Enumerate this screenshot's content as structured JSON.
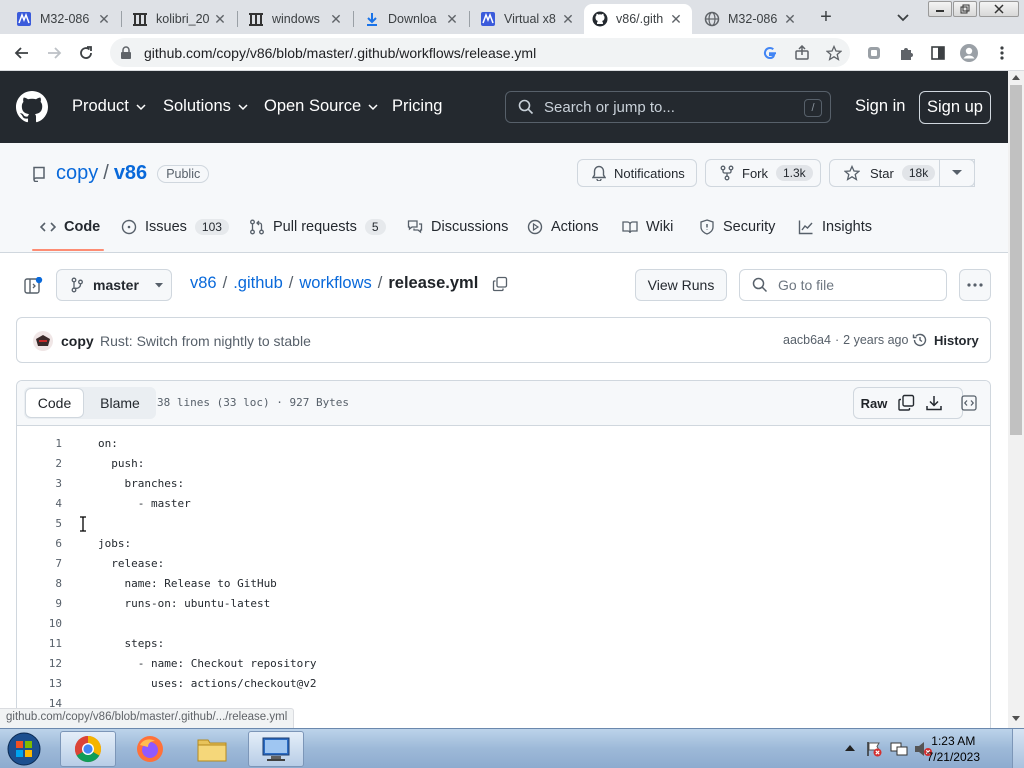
{
  "browser": {
    "tabs": [
      {
        "title": "M32-086",
        "icon": "m32-favicon-icon"
      },
      {
        "title": "kolibri_20",
        "icon": "archive-favicon-icon"
      },
      {
        "title": "windows",
        "icon": "archive-favicon-icon"
      },
      {
        "title": "Downloa",
        "icon": "download-icon"
      },
      {
        "title": "Virtual x8",
        "icon": "v86-favicon-icon"
      },
      {
        "title": "v86/.gith",
        "icon": "github-favicon-icon"
      },
      {
        "title": "M32-086",
        "icon": "globe-icon"
      }
    ],
    "url": "github.com/copy/v86/blob/master/.github/workflows/release.yml"
  },
  "gh_header": {
    "nav": [
      "Product",
      "Solutions",
      "Open Source",
      "Pricing"
    ],
    "search_placeholder": "Search or jump to...",
    "search_shortcut": "/",
    "sign_in": "Sign in",
    "sign_up": "Sign up"
  },
  "repo": {
    "owner": "copy",
    "separator": "/",
    "name": "v86",
    "visibility": "Public",
    "notifications": "Notifications",
    "fork_label": "Fork",
    "fork_count": "1.3k",
    "star_label": "Star",
    "star_count": "18k",
    "tabs": [
      {
        "label": "Code",
        "count": ""
      },
      {
        "label": "Issues",
        "count": "103"
      },
      {
        "label": "Pull requests",
        "count": "5"
      },
      {
        "label": "Discussions",
        "count": ""
      },
      {
        "label": "Actions",
        "count": ""
      },
      {
        "label": "Wiki",
        "count": ""
      },
      {
        "label": "Security",
        "count": ""
      },
      {
        "label": "Insights",
        "count": ""
      }
    ]
  },
  "filenav": {
    "branch": "master",
    "path": [
      "v86",
      ".github",
      "workflows"
    ],
    "sep": "/",
    "filename": "release.yml",
    "view_runs": "View Runs",
    "goto_placeholder": "Go to file"
  },
  "commit": {
    "author": "copy",
    "message": "Rust: Switch from nightly to stable",
    "sha": "aacb6a4",
    "dot": "·",
    "age": "2 years ago",
    "history": "History"
  },
  "file": {
    "code_tab": "Code",
    "blame_tab": "Blame",
    "info": "38 lines (33 loc) · 927 Bytes",
    "raw": "Raw",
    "lines": [
      {
        "n": "1",
        "t": "on:"
      },
      {
        "n": "2",
        "t": "  push:"
      },
      {
        "n": "3",
        "t": "    branches:"
      },
      {
        "n": "4",
        "t": "      - master"
      },
      {
        "n": "5",
        "t": ""
      },
      {
        "n": "6",
        "t": "jobs:"
      },
      {
        "n": "7",
        "t": "  release:"
      },
      {
        "n": "8",
        "t": "    name: Release to GitHub"
      },
      {
        "n": "9",
        "t": "    runs-on: ubuntu-latest"
      },
      {
        "n": "10",
        "t": ""
      },
      {
        "n": "11",
        "t": "    steps:"
      },
      {
        "n": "12",
        "t": "      - name: Checkout repository"
      },
      {
        "n": "13",
        "t": "        uses: actions/checkout@v2"
      },
      {
        "n": "14",
        "t": ""
      }
    ]
  },
  "status_url": "github.com/copy/v86/blob/master/.github/.../release.yml",
  "taskbar": {
    "time": "1:23 AM",
    "date": "7/21/2023"
  }
}
